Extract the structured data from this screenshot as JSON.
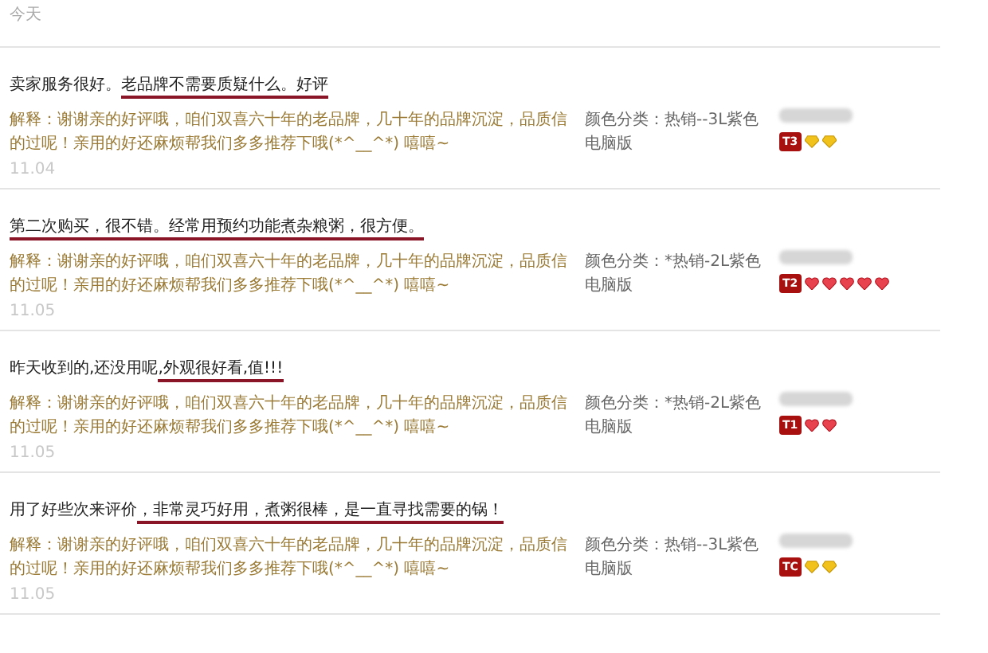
{
  "top_date": "今天",
  "reviews": [
    {
      "text_before": "卖家服务很好。",
      "text_underlined": "老品牌不需要质疑什么。好评",
      "reply": "解释：谢谢亲的好评哦，咱们双喜六十年的老品牌，几十年的品牌沉淀，品质信的过呢！亲用的好还麻烦帮我们多多推荐下哦(*^__^*) 嘻嘻~",
      "date": "11.04",
      "spec": "颜色分类：热销--3L紫色电脑版",
      "badge": "T3",
      "rank_icons": [
        {
          "kind": "diamond"
        },
        {
          "kind": "diamond"
        }
      ]
    },
    {
      "text_underlined": "第二次购买，很不错。经常用预约功能煮杂粮粥，很方便。",
      "reply": "解释：谢谢亲的好评哦，咱们双喜六十年的老品牌，几十年的品牌沉淀，品质信的过呢！亲用的好还麻烦帮我们多多推荐下哦(*^__^*) 嘻嘻~",
      "date": "11.05",
      "spec": "颜色分类：*热销-2L紫色电脑版",
      "badge": "T2",
      "rank_icons": [
        {
          "kind": "heart"
        },
        {
          "kind": "heart"
        },
        {
          "kind": "heart"
        },
        {
          "kind": "heart"
        },
        {
          "kind": "heart"
        }
      ]
    },
    {
      "text_before": "昨天收到的,还没用呢",
      "text_underlined": ",外观很好看,值!!!",
      "reply": "解释：谢谢亲的好评哦，咱们双喜六十年的老品牌，几十年的品牌沉淀，品质信的过呢！亲用的好还麻烦帮我们多多推荐下哦(*^__^*) 嘻嘻~",
      "date": "11.05",
      "spec": "颜色分类：*热销-2L紫色电脑版",
      "badge": "T1",
      "rank_icons": [
        {
          "kind": "heart"
        },
        {
          "kind": "heart"
        }
      ]
    },
    {
      "text_before": "用了好些次来评价",
      "text_underlined": "，非常灵巧好用，煮粥很棒，是一直寻找需要的锅！",
      "reply": "解释：谢谢亲的好评哦，咱们双喜六十年的老品牌，几十年的品牌沉淀，品质信的过呢！亲用的好还麻烦帮我们多多推荐下哦(*^__^*) 嘻嘻~",
      "date": "11.05",
      "spec": "颜色分类：热销--3L紫色电脑版",
      "badge": "TC",
      "rank_icons": [
        {
          "kind": "diamond"
        },
        {
          "kind": "diamond"
        }
      ]
    }
  ]
}
